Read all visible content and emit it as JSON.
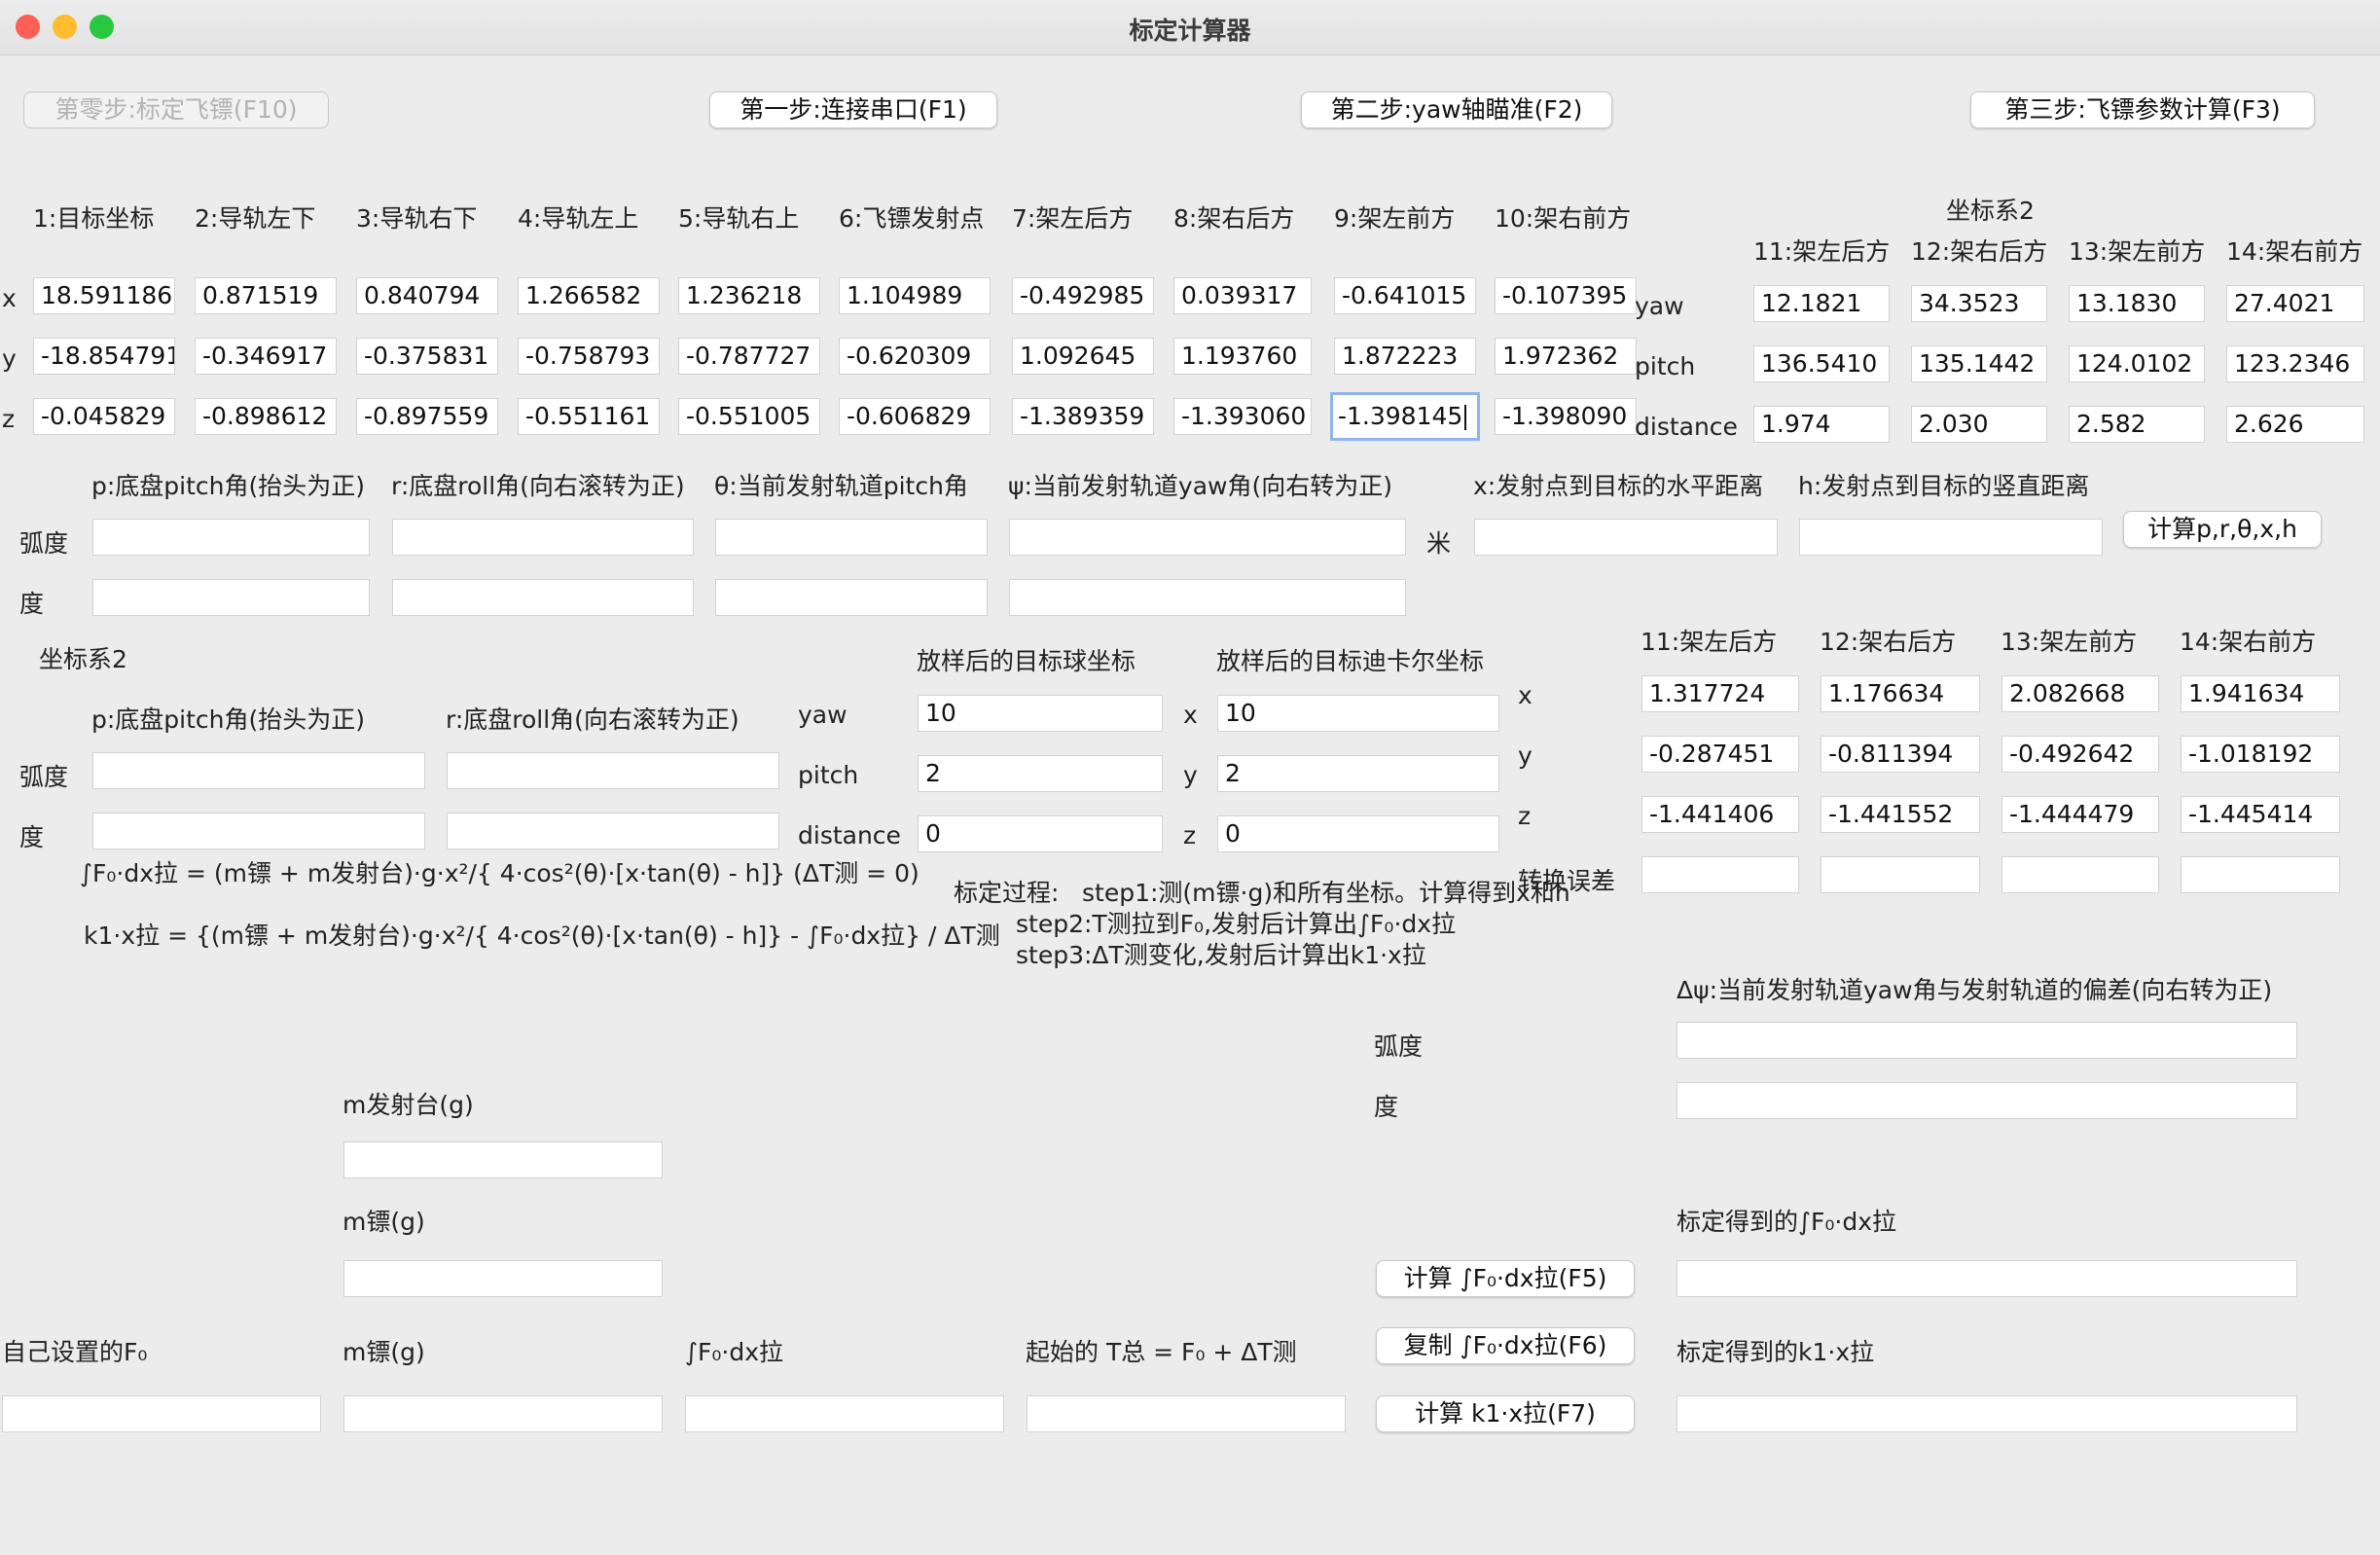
{
  "window": {
    "title": "标定计算器"
  },
  "buttons": {
    "step0": "第零步:标定飞镖(F10)",
    "step1": "第一步:连接串口(F1)",
    "step2": "第二步:yaw轴瞄准(F2)",
    "step3": "第三步:飞镖参数计算(F3)",
    "calc_prtxh": "计算p,r,θ,x,h",
    "calc_f5": "计算 ∫F₀·dx拉(F5)",
    "copy_f6": "复制 ∫F₀·dx拉(F6)",
    "calc_f7": "计算 k1·x拉(F7)"
  },
  "coords1": {
    "headers": [
      "1:目标坐标",
      "2:导轨左下",
      "3:导轨右下",
      "4:导轨左上",
      "5:导轨右上",
      "6:飞镖发射点",
      "7:架左后方",
      "8:架右后方",
      "9:架左前方",
      "10:架右前方"
    ],
    "row_labels": [
      "x",
      "y",
      "z"
    ],
    "x": [
      "18.591186",
      "0.871519",
      "0.840794",
      "1.266582",
      "1.236218",
      "1.104989",
      "-0.492985",
      "0.039317",
      "-0.641015",
      "-0.107395"
    ],
    "y": [
      "-18.854791",
      "-0.346917",
      "-0.375831",
      "-0.758793",
      "-0.787727",
      "-0.620309",
      "1.092645",
      "1.193760",
      "1.872223",
      "1.972362"
    ],
    "z": [
      "-0.045829",
      "-0.898612",
      "-0.897559",
      "-0.551161",
      "-0.551005",
      "-0.606829",
      "-1.389359",
      "-1.393060",
      "-1.398145",
      "-1.398090"
    ]
  },
  "coords2": {
    "title": "坐标系2",
    "headers": [
      "11:架左后方",
      "12:架右后方",
      "13:架左前方",
      "14:架右前方"
    ],
    "row_labels": [
      "yaw",
      "pitch",
      "distance"
    ],
    "yaw": [
      "12.1821",
      "34.3523",
      "13.1830",
      "27.4021"
    ],
    "pitch": [
      "136.5410",
      "135.1442",
      "124.0102",
      "123.2346"
    ],
    "distance": [
      "1.974",
      "2.030",
      "2.582",
      "2.626"
    ]
  },
  "angles": {
    "headers": [
      "p:底盘pitch角(抬头为正)",
      "r:底盘roll角(向右滚转为正)",
      "θ:当前发射轨道pitch角",
      "ψ:当前发射轨道yaw角(向右转为正)",
      "x:发射点到目标的水平距离",
      "h:发射点到目标的竖直距离"
    ],
    "rad_label": "弧度",
    "deg_label": "度",
    "meter_label": "米"
  },
  "sys2": {
    "title": "坐标系2",
    "headers": [
      "p:底盘pitch角(抬头为正)",
      "r:底盘roll角(向右滚转为正)"
    ],
    "rad_label": "弧度",
    "deg_label": "度"
  },
  "lofted": {
    "spherical_title": "放样后的目标球坐标",
    "cartesian_title": "放样后的目标迪卡尔坐标",
    "sph_labels": [
      "yaw",
      "pitch",
      "distance"
    ],
    "sph_values": [
      "10",
      "2",
      "0"
    ],
    "cart_labels": [
      "x",
      "y",
      "z"
    ],
    "cart_values": [
      "10",
      "2",
      "0"
    ]
  },
  "frame_table": {
    "headers": [
      "11:架左后方",
      "12:架右后方",
      "13:架左前方",
      "14:架右前方"
    ],
    "row_labels": [
      "x",
      "y",
      "z",
      "转换误差"
    ],
    "x": [
      "1.317724",
      "1.176634",
      "2.082668",
      "1.941634"
    ],
    "y": [
      "-0.287451",
      "-0.811394",
      "-0.492642",
      "-1.018192"
    ],
    "z": [
      "-1.441406",
      "-1.441552",
      "-1.444479",
      "-1.445414"
    ]
  },
  "formulas": {
    "f1": "∫F₀·dx拉 = (m镖 + m发射台)·g·x²/{ 4·cos²(θ)·[x·tan(θ)  - h]}    (ΔT测 = 0)",
    "f2": "k1·x拉 = {(m镖 + m发射台)·g·x²/{ 4·cos²(θ)·[x·tan(θ)  - h]} - ∫F₀·dx拉} / ΔT测"
  },
  "process": {
    "label": "标定过程:",
    "step1": "step1:测(m镖·g)和所有坐标。计算得到x和h",
    "step2": "step2:T测拉到F₀,发射后计算出∫F₀·dx拉",
    "step3": "step3:ΔT测变化,发射后计算出k1·x拉"
  },
  "delta_psi": {
    "title": "Δψ:当前发射轨道yaw角与发射轨道的偏差(向右转为正)",
    "rad_label": "弧度",
    "deg_label": "度"
  },
  "mass": {
    "m_platform": "m发射台(g)",
    "m_dart": "m镖(g)"
  },
  "bottom": {
    "labels": [
      "自己设置的F₀",
      "m镖(g)",
      "∫F₀·dx拉",
      "起始的 T总 = F₀ + ΔT测"
    ],
    "cal_f0_label": "标定得到的∫F₀·dx拉",
    "cal_k1_label": "标定得到的k1·x拉"
  },
  "colors": {
    "close": "#fe5f57",
    "minimize": "#febc2e",
    "zoom": "#28c840",
    "focus_ring": "#8fb4ea"
  }
}
